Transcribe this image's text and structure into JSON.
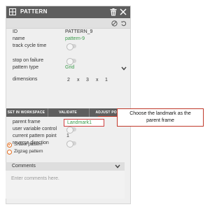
{
  "window": {
    "title": "PATTERN"
  },
  "fields": {
    "id": {
      "label": "ID",
      "value": "PATTERN_9"
    },
    "name": {
      "label": "name",
      "value": "pattern-9"
    },
    "track_cycle_time": {
      "label": "track cycle time"
    },
    "stop_on_failure": {
      "label": "stop on failure"
    },
    "pattern_type": {
      "label": "pattern type",
      "value": "Grid"
    },
    "dimensions": {
      "label": "dimensions",
      "values": [
        "2",
        "x",
        "3",
        "x",
        "1"
      ]
    }
  },
  "buttons": {
    "set_in_workspace": "SET IN WORKSPACE",
    "validate": "VALIDATE",
    "adjust_poses": "ADJUST POSES"
  },
  "frame": {
    "parent_frame": {
      "label": "parent frame",
      "value": "Landmark1"
    },
    "user_variable_control": {
      "label": "user variable control"
    },
    "current_pattern_point": {
      "label": "current pattern point",
      "value": "1"
    },
    "reverse_direction": {
      "label": "reverse direction"
    }
  },
  "radios": [
    {
      "label": "Snake pattern",
      "selected": true
    },
    {
      "label": "Zigzag pattern",
      "selected": false
    }
  ],
  "comments": {
    "header": "Comments",
    "placeholder": "Enter comments here."
  },
  "callout": {
    "line1": "Choose the landmark as the",
    "line2": "parent frame"
  },
  "colors": {
    "accent_green": "#3a9b4a",
    "radio_orange": "#e36d1f",
    "callout_red": "#c0392b",
    "header_dark": "#5e5e5e"
  },
  "icons": [
    "grid-icon",
    "trash-icon",
    "close-icon",
    "block-icon",
    "undo-icon",
    "chevron-down-icon"
  ]
}
